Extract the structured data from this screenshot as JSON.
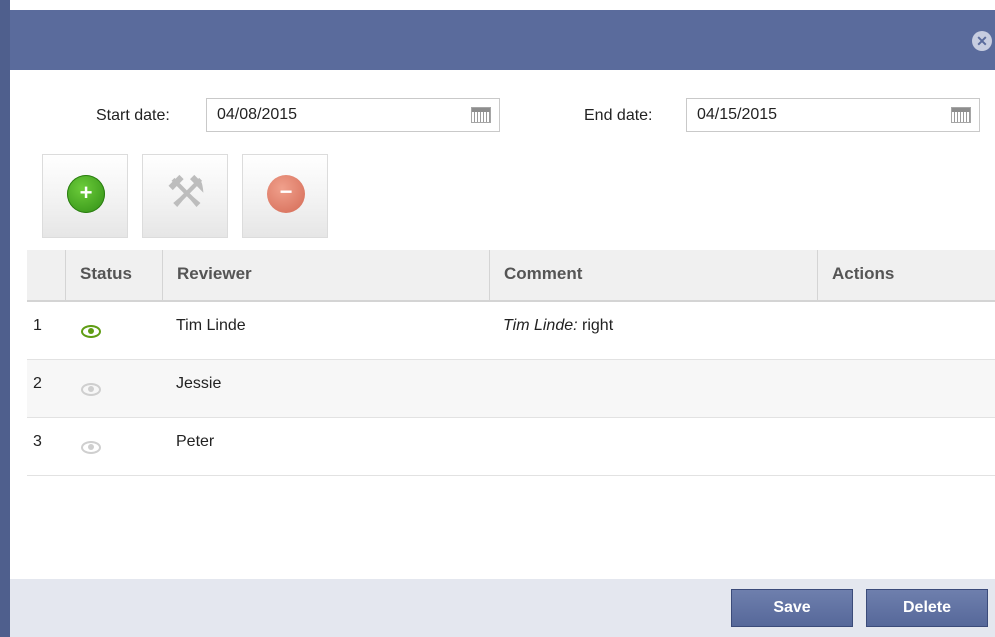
{
  "dialog": {
    "close_glyph": "✕"
  },
  "filters": {
    "start_label": "Start date:",
    "start_value": "04/08/2015",
    "end_label": "End date:",
    "end_value": "04/15/2015"
  },
  "toolbar": {
    "add_glyph": "+",
    "edit_glyph": "⚒",
    "remove_glyph": "−"
  },
  "table": {
    "columns": [
      "",
      "Status",
      "Reviewer",
      "Comment",
      "Actions"
    ],
    "rows": [
      {
        "num": "1",
        "status": "viewed",
        "reviewer": "Tim Linde",
        "comment_author": "Tim Linde:",
        "comment_text": " right"
      },
      {
        "num": "2",
        "status": "not-viewed",
        "reviewer": "Jessie",
        "comment_author": "",
        "comment_text": ""
      },
      {
        "num": "3",
        "status": "not-viewed",
        "reviewer": "Peter",
        "comment_author": "",
        "comment_text": ""
      }
    ]
  },
  "footer": {
    "save_label": "Save",
    "delete_label": "Delete"
  },
  "colors": {
    "titlebar": "#5a6b9c",
    "accent_green": "#5f9d14",
    "button_blue": "#5a6b9c"
  }
}
